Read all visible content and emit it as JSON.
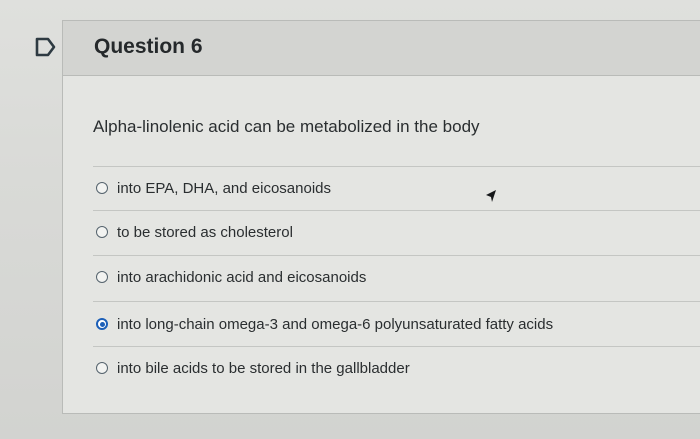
{
  "question": {
    "title": "Question 6",
    "text": "Alpha-linolenic acid can be metabolized in the body"
  },
  "options": [
    {
      "label": "into EPA, DHA, and eicosanoids",
      "selected": false
    },
    {
      "label": "to be stored as cholesterol",
      "selected": false
    },
    {
      "label": "into arachidonic acid and eicosanoids",
      "selected": false
    },
    {
      "label": "into long-chain omega-3 and omega-6 polyunsaturated fatty acids",
      "selected": true
    },
    {
      "label": "into bile acids to be stored in the gallbladder",
      "selected": false
    }
  ],
  "icons": {
    "flag": "flag-icon",
    "cursor": "mouse-cursor-icon"
  },
  "colors": {
    "selected_radio": "#1c5fb8",
    "background": "#dfe0dd",
    "header": "#d3d4d1"
  }
}
